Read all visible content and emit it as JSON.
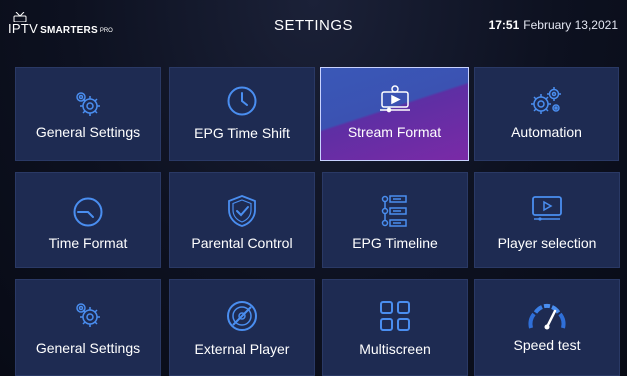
{
  "header": {
    "brand_main": "IPTV",
    "brand_sub": "SMARTERS",
    "brand_pro": "PRO",
    "title": "SETTINGS",
    "time": "17:51",
    "date": "February 13,2021"
  },
  "tiles": [
    {
      "label": "General Settings",
      "icon": "gears-icon",
      "selected": false
    },
    {
      "label": "EPG Time Shift",
      "icon": "clock-icon",
      "selected": false
    },
    {
      "label": "Stream Format",
      "icon": "stream-format-icon",
      "selected": true
    },
    {
      "label": "Automation",
      "icon": "automation-gears-icon",
      "selected": false
    },
    {
      "label": "Time Format",
      "icon": "clock-icon",
      "selected": false
    },
    {
      "label": "Parental  Control",
      "icon": "shield-check-icon",
      "selected": false
    },
    {
      "label": "EPG Timeline",
      "icon": "timeline-icon",
      "selected": false
    },
    {
      "label": "Player selection",
      "icon": "player-icon",
      "selected": false
    },
    {
      "label": "General Settings",
      "icon": "gears-icon",
      "selected": false
    },
    {
      "label": "External Player",
      "icon": "disc-icon",
      "selected": false
    },
    {
      "label": "Multiscreen",
      "icon": "grid-icon",
      "selected": false
    },
    {
      "label": "Speed test",
      "icon": "speedometer-icon",
      "selected": false
    }
  ],
  "colors": {
    "background": "#0d1120",
    "tile": "#1e2b52",
    "icon_blue": "#4a8ef0",
    "selected_gradient": [
      "#3b52b2",
      "#7a2aa6"
    ]
  }
}
